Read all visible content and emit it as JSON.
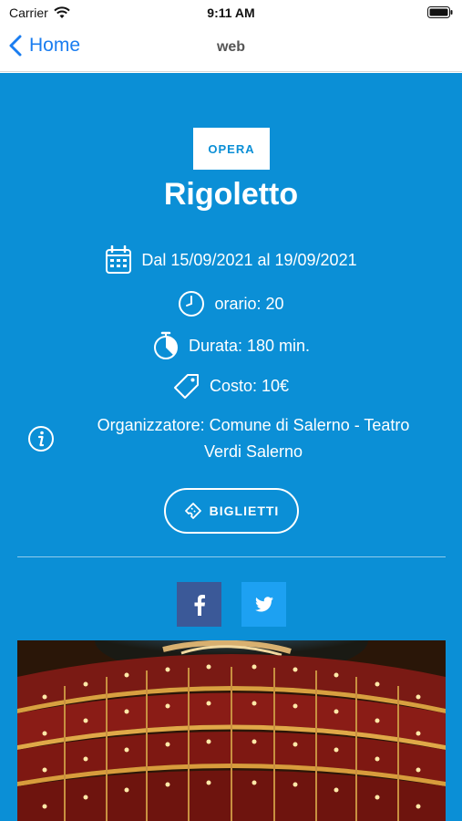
{
  "status_bar": {
    "carrier": "Carrier",
    "time": "9:11 AM"
  },
  "nav": {
    "back_label": "Home",
    "title": "web"
  },
  "event": {
    "category": "OPERA",
    "title": "Rigoletto",
    "dates": "Dal 15/09/2021 al 19/09/2021",
    "time": "orario: 20",
    "duration": "Durata: 180 min.",
    "cost": "Costo: 10€",
    "organizer_line1": "Organizzatore: Comune di Salerno - Teatro",
    "organizer_line2": "Verdi Salerno"
  },
  "actions": {
    "tickets_label": "BIGLIETTI"
  },
  "colors": {
    "background": "#0b8fd6",
    "facebook": "#3b5998",
    "twitter": "#1da1f2",
    "ios_blue": "#1a7df0"
  },
  "icons": [
    "wifi-icon",
    "battery-icon",
    "chevron-left-icon",
    "calendar-icon",
    "clock-icon",
    "stopwatch-icon",
    "tag-icon",
    "info-icon",
    "ticket-icon",
    "facebook-icon",
    "twitter-icon"
  ]
}
